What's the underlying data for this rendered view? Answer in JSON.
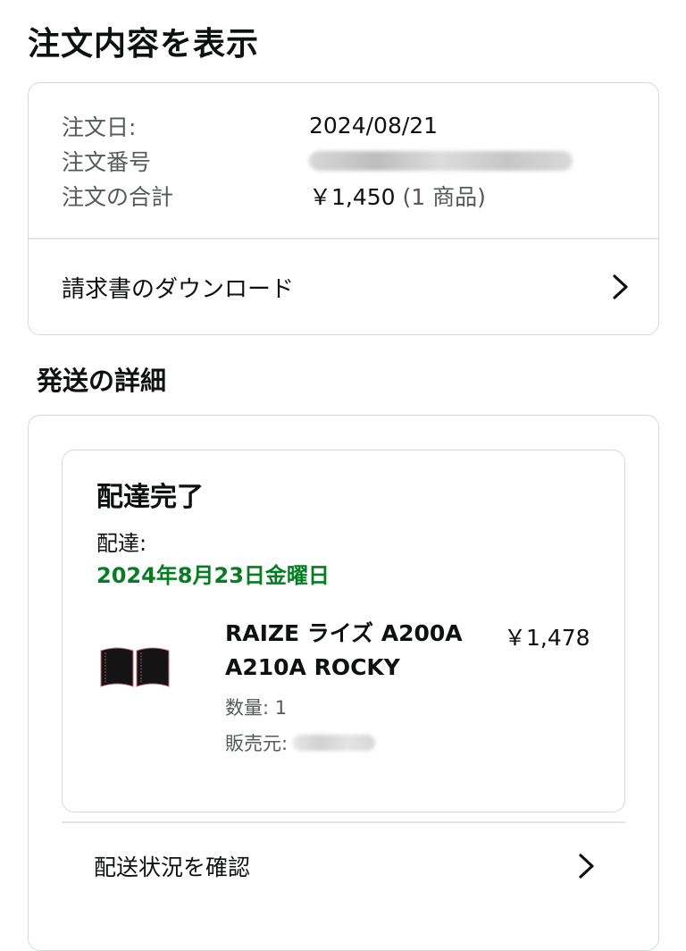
{
  "page": {
    "title": "注文内容を表示"
  },
  "order_summary": {
    "date_label": "注文日:",
    "date_value": "2024/08/21",
    "number_label": "注文番号",
    "total_label": "注文の合計",
    "total_value": "￥1,450",
    "items_count": "(1 商品)"
  },
  "invoice": {
    "label": "請求書のダウンロード",
    "icon": "chevron-right-icon"
  },
  "shipping": {
    "section_title": "発送の詳細",
    "status": "配達完了",
    "delivery_label": "配達:",
    "delivery_date": "2024年8月23日金曜日",
    "accent_color": "#067d22",
    "item": {
      "title": "RAIZE ライズ A200A A210A ROCKY",
      "price": "￥1,478",
      "quantity": "数量: 1",
      "seller_label": "販売元:"
    },
    "track_label": "配送状況を確認",
    "track_icon": "chevron-right-icon"
  }
}
